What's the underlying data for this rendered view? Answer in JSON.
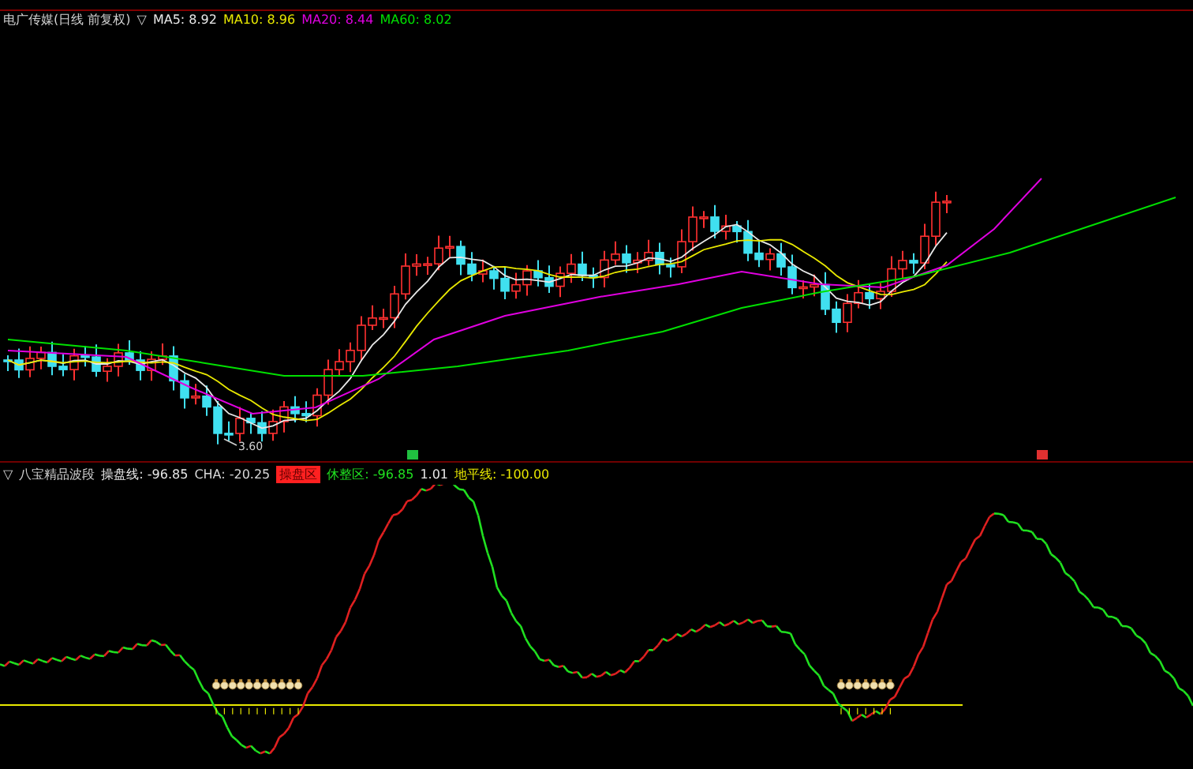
{
  "chart_header": {
    "title": "电广传媒(日线 前复权)",
    "toggle": "▽",
    "averages": [
      {
        "label": "MA5: 8.92",
        "color": "#e8e8e8"
      },
      {
        "label": "MA10: 8.96",
        "color": "#e8e800"
      },
      {
        "label": "MA20: 8.44",
        "color": "#e000e0"
      },
      {
        "label": "MA60: 8.02",
        "color": "#00e000"
      }
    ]
  },
  "low_price_label": "3.60",
  "indicator_header": {
    "toggle": "▽",
    "title": "八宝精品波段",
    "items": [
      {
        "kind": "text",
        "label": "操盘线: -96.85",
        "color": "#e8e8e8"
      },
      {
        "kind": "text",
        "label": "CHA: -20.25",
        "color": "#d8d8d8"
      },
      {
        "kind": "badge",
        "label": "操盘区",
        "color": "#ff2020"
      },
      {
        "kind": "text",
        "label": "休整区: -96.85",
        "color": "#20e020"
      },
      {
        "kind": "text",
        "label": "1.01",
        "color": "#e8e8e8"
      },
      {
        "kind": "text",
        "label": "地平线: -100.00",
        "color": "#e8e800"
      }
    ]
  }
}
